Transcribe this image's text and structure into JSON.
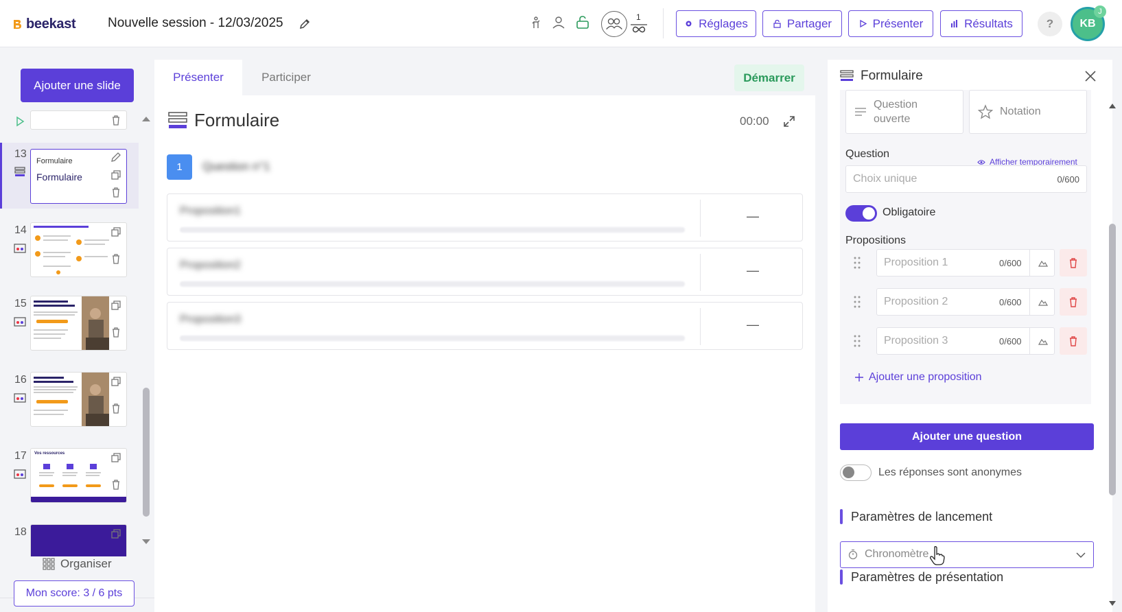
{
  "app": {
    "logo_text": "beekast",
    "session_title": "Nouvelle session - 12/03/2025"
  },
  "colors": {
    "brand": "#5b3fd9",
    "start_bg": "#e4f6ec",
    "start_text": "#2a9a5b",
    "badge_blue": "#4a8ef0",
    "logo_orange": "#f29a1a"
  },
  "topbar": {
    "participants_count": "1",
    "buttons": {
      "settings": "Réglages",
      "share": "Partager",
      "present": "Présenter",
      "results": "Résultats"
    },
    "help": "?",
    "avatar_initials": "KB",
    "avatar_badge": "J"
  },
  "left": {
    "add_slide": "Ajouter une slide",
    "slides": [
      {
        "num": "13",
        "title_small": "Formulaire",
        "title": "Formulaire"
      },
      {
        "num": "14"
      },
      {
        "num": "15"
      },
      {
        "num": "16"
      },
      {
        "num": "17",
        "thumb_title": "Vos ressources"
      },
      {
        "num": "18"
      }
    ],
    "organiser": "Organiser",
    "score": "Mon score: 3 / 6 pts"
  },
  "center": {
    "tabs": [
      "Présenter",
      "Participer"
    ],
    "start": "Démarrer",
    "title": "Formulaire",
    "timer": "00:00",
    "question_num": "1",
    "question_text": "Question n°1",
    "propositions": [
      {
        "text": "Proposition1",
        "value": "—"
      },
      {
        "text": "Proposition2",
        "value": "—"
      },
      {
        "text": "Proposition3",
        "value": "—"
      }
    ]
  },
  "right": {
    "title": "Formulaire",
    "types": [
      "Question ouverte",
      "Notation"
    ],
    "question_label": "Question",
    "afficher": "Afficher temporairement",
    "question_placeholder": "Choix unique",
    "question_count": "0/600",
    "obligatoire": "Obligatoire",
    "propositions_label": "Propositions",
    "propositions": [
      {
        "placeholder": "Proposition 1",
        "count": "0/600"
      },
      {
        "placeholder": "Proposition 2",
        "count": "0/600"
      },
      {
        "placeholder": "Proposition 3",
        "count": "0/600"
      }
    ],
    "add_proposition": "Ajouter une proposition",
    "add_question": "Ajouter une question",
    "anonymous": "Les réponses sont anonymes",
    "launch_params": "Paramètres de lancement",
    "timer_select": "Chronomètre",
    "presentation_params": "Paramètres de présentation"
  }
}
